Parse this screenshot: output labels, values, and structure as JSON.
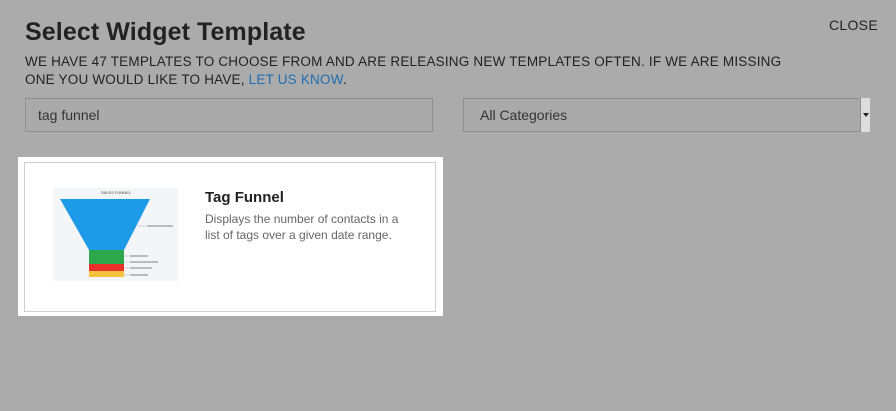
{
  "header": {
    "title": "Select Widget Template",
    "close_label": "CLOSE"
  },
  "intro": {
    "text": "WE HAVE 47 TEMPLATES TO CHOOSE FROM AND ARE RELEASING NEW TEMPLATES OFTEN. IF WE ARE MISSING ONE YOU WOULD LIKE TO HAVE,",
    "link_label": "LET US KNOW",
    "suffix": "."
  },
  "search": {
    "value": "tag funnel"
  },
  "category_select": {
    "selected": "All Categories"
  },
  "results": [
    {
      "title": "Tag Funnel",
      "description": "Displays the number of contacts in a list of tags over a given date range.",
      "thumbnail": {
        "caption": "SALES FUNNEL",
        "colors": {
          "top": "#1e9be8",
          "middle": "#2ca84a",
          "lower": "#e8312b",
          "bottom": "#f5c33b"
        }
      }
    }
  ],
  "colors": {
    "background": "#ababab",
    "link": "#1f6db3"
  }
}
